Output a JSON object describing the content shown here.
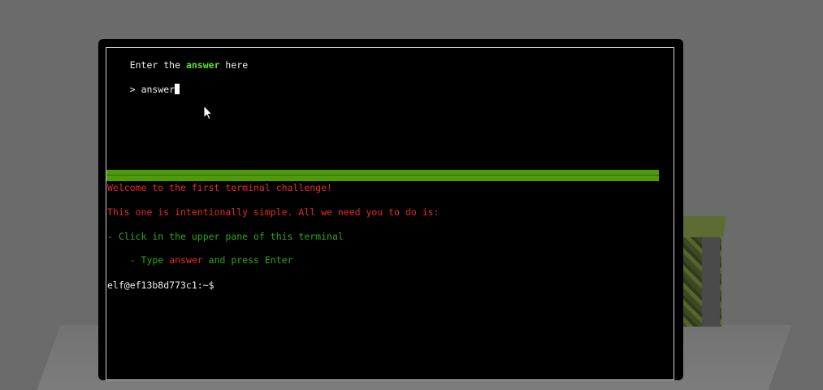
{
  "upper_pane": {
    "prompt_before": "Enter the ",
    "prompt_highlight": "answer",
    "prompt_after": " here",
    "input_prefix": "> ",
    "input_value": "answer"
  },
  "lower_pane": {
    "welcome": "Welcome to the first terminal challenge!",
    "intro": "This one is intentionally simple. All we need you to do is:",
    "step1": "- Click in the upper pane of this terminal",
    "step2_before": "- Type ",
    "step2_highlight": "answer",
    "step2_after": " and press Enter",
    "shell_prompt": "elf@ef13b8d773c1:~$"
  },
  "colors": {
    "background": "#6b6b6b",
    "terminal_bg": "#000000",
    "highlight_green": "#5ce02b",
    "message_red": "#e32b2b",
    "step_green": "#2fa81b",
    "divider_green": "#4f9a0b"
  }
}
